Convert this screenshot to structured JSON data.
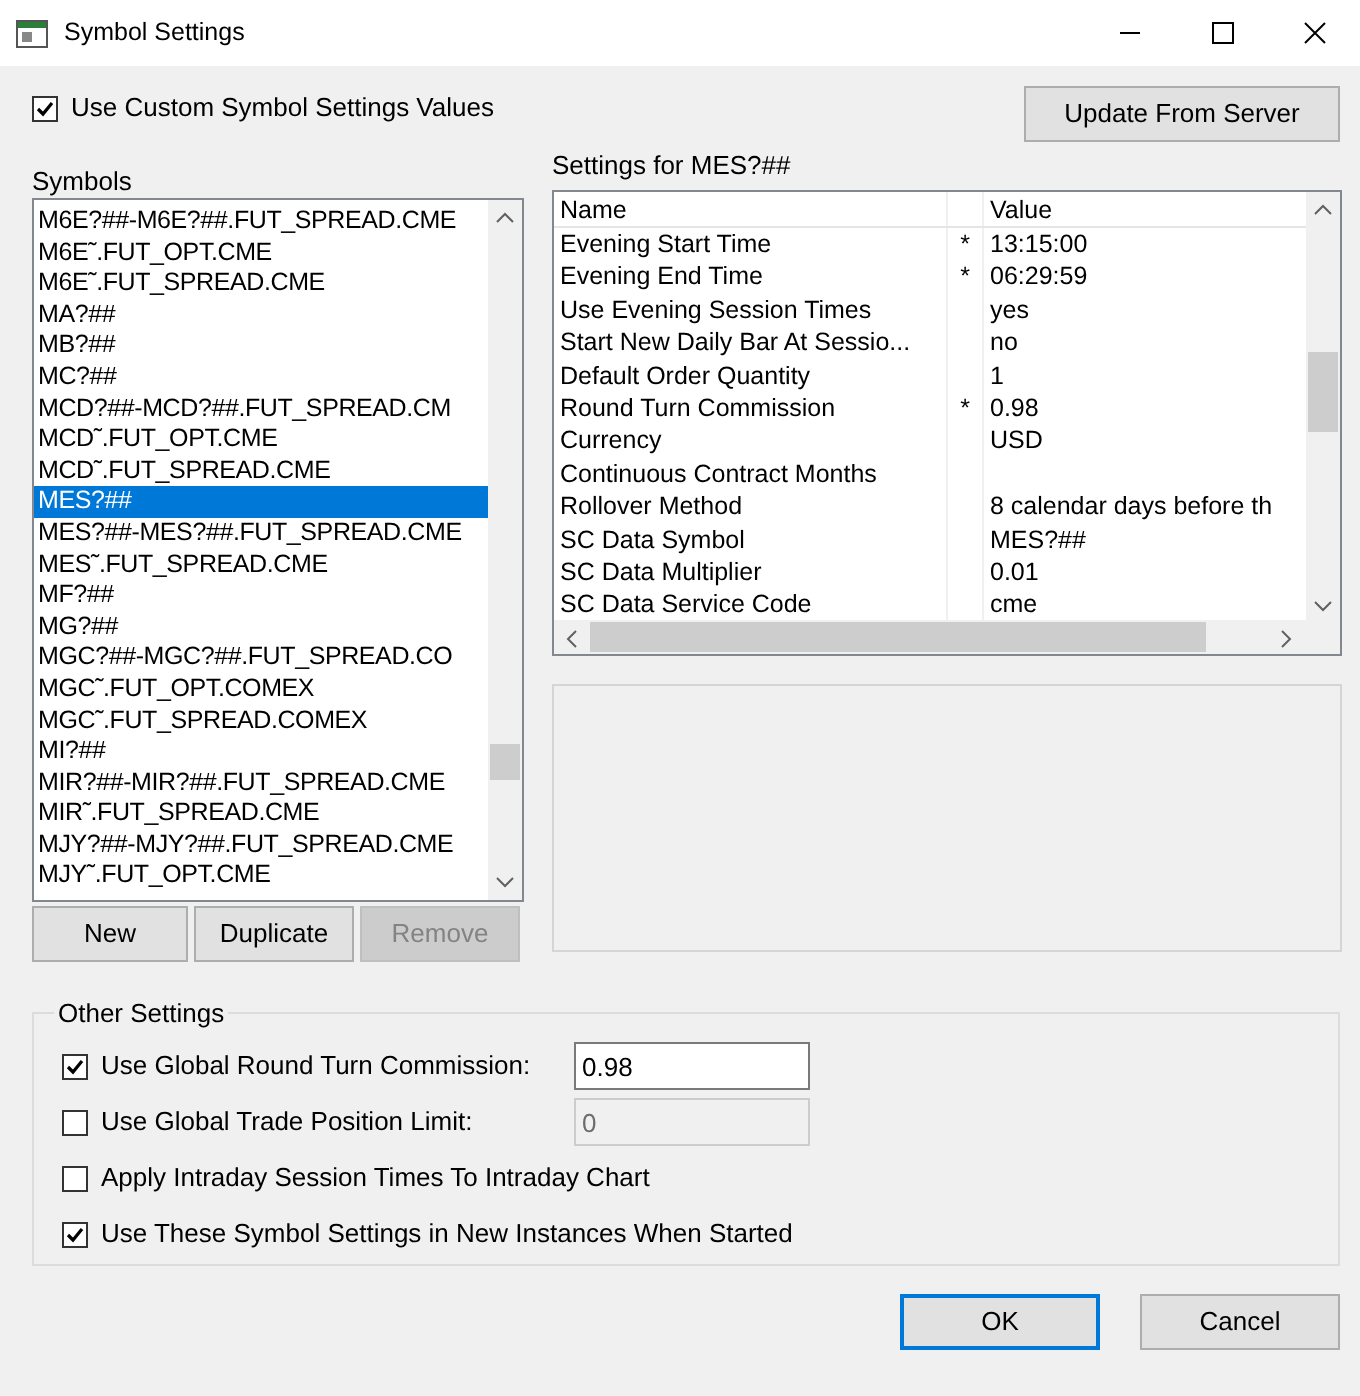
{
  "window": {
    "title": "Symbol Settings"
  },
  "use_custom": {
    "label": "Use Custom Symbol Settings Values",
    "checked": true
  },
  "update_button": {
    "label": "Update From Server"
  },
  "symbols": {
    "label": "Symbols",
    "items": [
      {
        "text": "M6E?##-M6E?##.FUT_SPREAD.CME",
        "selected": false
      },
      {
        "text": "M6E˜.FUT_OPT.CME",
        "selected": false
      },
      {
        "text": "M6E˜.FUT_SPREAD.CME",
        "selected": false
      },
      {
        "text": "MA?##",
        "selected": false
      },
      {
        "text": "MB?##",
        "selected": false
      },
      {
        "text": "MC?##",
        "selected": false
      },
      {
        "text": "MCD?##-MCD?##.FUT_SPREAD.CM",
        "selected": false
      },
      {
        "text": "MCD˜.FUT_OPT.CME",
        "selected": false
      },
      {
        "text": "MCD˜.FUT_SPREAD.CME",
        "selected": false
      },
      {
        "text": "MES?##",
        "selected": true
      },
      {
        "text": "MES?##-MES?##.FUT_SPREAD.CME",
        "selected": false
      },
      {
        "text": "MES˜.FUT_SPREAD.CME",
        "selected": false
      },
      {
        "text": "MF?##",
        "selected": false
      },
      {
        "text": "MG?##",
        "selected": false
      },
      {
        "text": "MGC?##-MGC?##.FUT_SPREAD.CO",
        "selected": false
      },
      {
        "text": "MGC˜.FUT_OPT.COMEX",
        "selected": false
      },
      {
        "text": "MGC˜.FUT_SPREAD.COMEX",
        "selected": false
      },
      {
        "text": "MI?##",
        "selected": false
      },
      {
        "text": "MIR?##-MIR?##.FUT_SPREAD.CME",
        "selected": false
      },
      {
        "text": "MIR˜.FUT_SPREAD.CME",
        "selected": false
      },
      {
        "text": "MJY?##-MJY?##.FUT_SPREAD.CME",
        "selected": false
      },
      {
        "text": "MJY˜.FUT_OPT.CME",
        "selected": false
      }
    ]
  },
  "list_buttons": [
    {
      "label": "New",
      "disabled": false
    },
    {
      "label": "Duplicate",
      "disabled": false
    },
    {
      "label": "Remove",
      "disabled": true
    }
  ],
  "settings": {
    "title": "Settings for MES?##",
    "columns": [
      "Name",
      "Value"
    ],
    "rows": [
      {
        "name": "Evening Start Time",
        "flag": "*",
        "value": "13:15:00"
      },
      {
        "name": "Evening End Time",
        "flag": "*",
        "value": "06:29:59"
      },
      {
        "name": "Use Evening Session Times",
        "value": "yes"
      },
      {
        "name": "Start New Daily Bar At Sessio...",
        "value": "no"
      },
      {
        "name": "Default Order Quantity",
        "value": "1"
      },
      {
        "name": "Round Turn Commission",
        "flag": "*",
        "value": "0.98"
      },
      {
        "name": "Currency",
        "value": "USD"
      },
      {
        "name": "Continuous Contract Months"
      },
      {
        "name": "Rollover Method",
        "value": "8 calendar days before th"
      },
      {
        "name": "SC Data Symbol",
        "value": "MES?##"
      },
      {
        "name": "SC Data Multiplier",
        "value": "0.01"
      },
      {
        "name": "SC Data Service Code",
        "value": "cme"
      }
    ]
  },
  "other_settings": {
    "title": "Other Settings",
    "options": [
      {
        "kind": "field",
        "label": "Use Global Round Turn Commission:",
        "checked": true,
        "value": "0.98",
        "disabled": false
      },
      {
        "kind": "field",
        "label": "Use Global Trade Position Limit:",
        "checked": false,
        "value": "0",
        "disabled": true
      },
      {
        "kind": "check",
        "label": "Apply Intraday Session Times To Intraday Chart",
        "checked": false
      },
      {
        "kind": "check",
        "label": "Use These Symbol Settings in New Instances When Started",
        "checked": true
      }
    ]
  },
  "dialog_buttons": [
    {
      "label": "OK",
      "default": true
    },
    {
      "label": "Cancel",
      "default": false
    }
  ]
}
